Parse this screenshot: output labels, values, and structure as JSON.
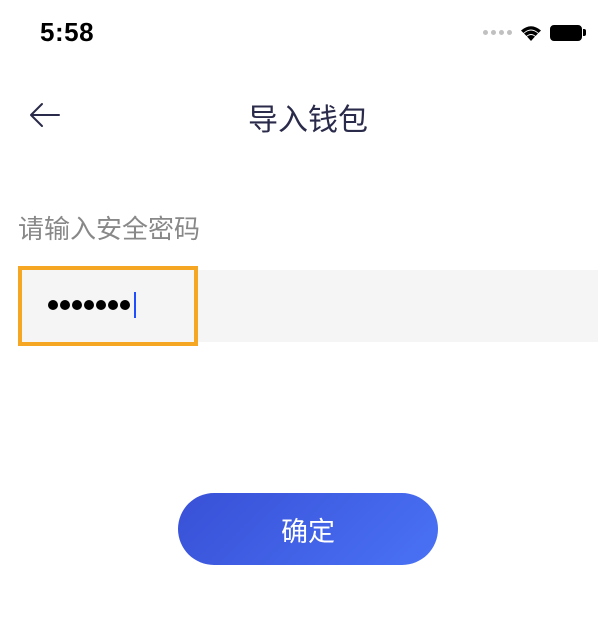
{
  "statusBar": {
    "time": "5:58"
  },
  "nav": {
    "title": "导入钱包"
  },
  "form": {
    "passwordLabel": "请输入安全密码",
    "passwordDotsCount": 7
  },
  "actions": {
    "confirmLabel": "确定"
  }
}
